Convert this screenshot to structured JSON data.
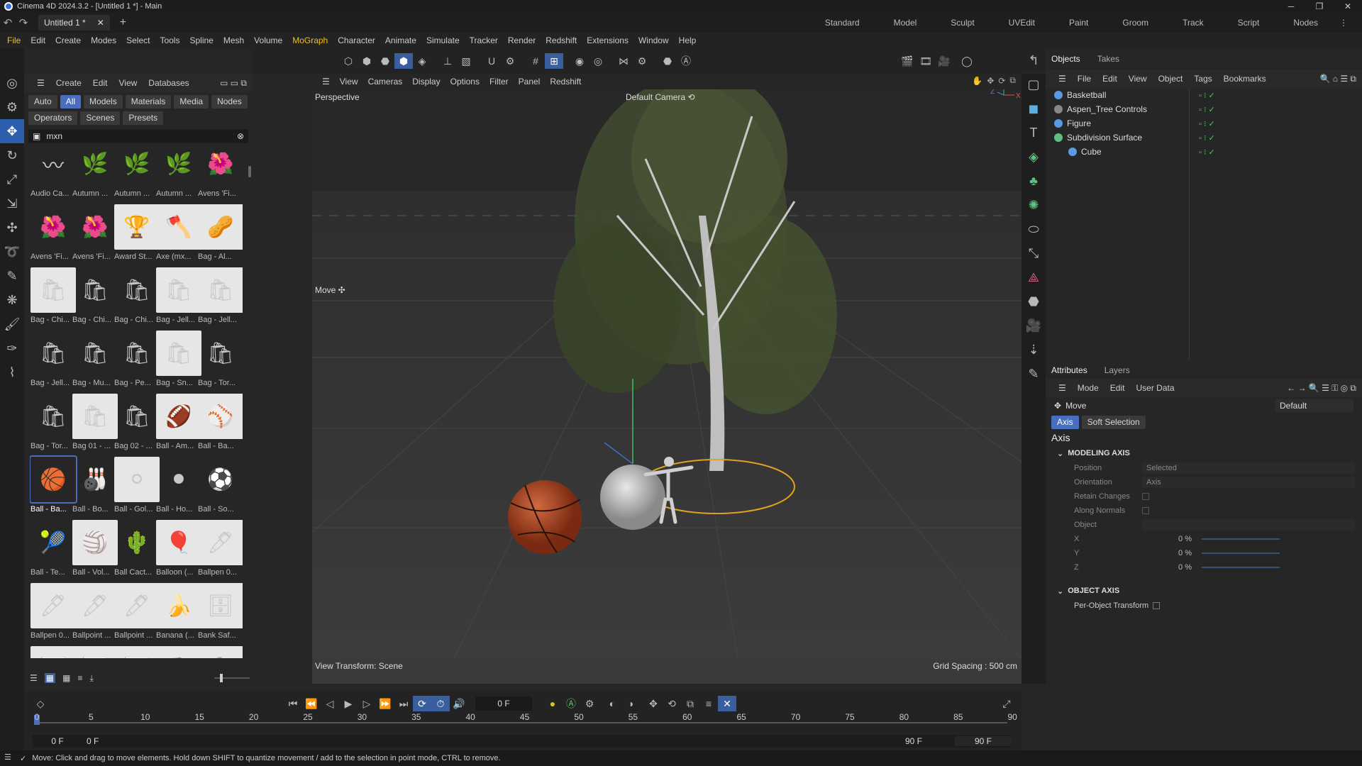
{
  "window": {
    "title": "Cinema 4D 2024.3.2 - [Untitled 1 *] - Main",
    "minimize": "─",
    "maximize": "❐",
    "close": "✕"
  },
  "tabs": {
    "doc": "Untitled 1 *",
    "close": "✕",
    "add": "+",
    "layouts": [
      "Standard",
      "Model",
      "Sculpt",
      "UVEdit",
      "Paint",
      "Groom",
      "Track",
      "Script",
      "Nodes"
    ]
  },
  "menu": [
    "File",
    "Edit",
    "Create",
    "Modes",
    "Select",
    "Tools",
    "Spline",
    "Mesh",
    "Volume",
    "MoGraph",
    "Character",
    "Animate",
    "Simulate",
    "Tracker",
    "Render",
    "Redshift",
    "Extensions",
    "Window",
    "Help"
  ],
  "axes_toolbar": [
    "X",
    "Y",
    "Z"
  ],
  "assets": {
    "menu": [
      "Create",
      "Edit",
      "View",
      "Databases"
    ],
    "chips": [
      "Auto",
      "All",
      "Models",
      "Materials",
      "Media",
      "Nodes",
      "Operators",
      "Scenes",
      "Presets"
    ],
    "search": "mxn",
    "items": [
      {
        "label": "Audio Ca...",
        "icon": "〰"
      },
      {
        "label": "Autumn ...",
        "icon": "🌿"
      },
      {
        "label": "Autumn ...",
        "icon": "🌿"
      },
      {
        "label": "Autumn ...",
        "icon": "🌿"
      },
      {
        "label": "Avens 'Fi...",
        "icon": "🌺"
      },
      {
        "label": "Avens 'Fi...",
        "icon": "🌺"
      },
      {
        "label": "Avens 'Fi...",
        "icon": "🌺"
      },
      {
        "label": "Award St...",
        "icon": "🏆"
      },
      {
        "label": "Axe (mx...",
        "icon": "🪓"
      },
      {
        "label": "Bag - Al...",
        "icon": "🥜"
      },
      {
        "label": "Bag - Chi...",
        "icon": "🛍"
      },
      {
        "label": "Bag - Chi...",
        "icon": "🛍"
      },
      {
        "label": "Bag - Chi...",
        "icon": "🛍"
      },
      {
        "label": "Bag - Jell...",
        "icon": "🛍"
      },
      {
        "label": "Bag - Jell...",
        "icon": "🛍"
      },
      {
        "label": "Bag - Jell...",
        "icon": "🛍"
      },
      {
        "label": "Bag - Mu...",
        "icon": "🛍"
      },
      {
        "label": "Bag - Pe...",
        "icon": "🛍"
      },
      {
        "label": "Bag - Sn...",
        "icon": "🛍"
      },
      {
        "label": "Bag - Tor...",
        "icon": "🛍"
      },
      {
        "label": "Bag - Tor...",
        "icon": "🛍"
      },
      {
        "label": "Bag 01 - ...",
        "icon": "🛍"
      },
      {
        "label": "Bag 02 - ...",
        "icon": "🛍"
      },
      {
        "label": "Ball - Am...",
        "icon": "🏈"
      },
      {
        "label": "Ball - Ba...",
        "icon": "⚾"
      },
      {
        "label": "Ball - Ba...",
        "icon": "🏀"
      },
      {
        "label": "Ball - Bo...",
        "icon": "🎳"
      },
      {
        "label": "Ball - Gol...",
        "icon": "⚪"
      },
      {
        "label": "Ball - Ho...",
        "icon": "⚫"
      },
      {
        "label": "Ball - So...",
        "icon": "⚽"
      },
      {
        "label": "Ball - Te...",
        "icon": "🎾"
      },
      {
        "label": "Ball - Vol...",
        "icon": "🏐"
      },
      {
        "label": "Ball Cact...",
        "icon": "🌵"
      },
      {
        "label": "Balloon (...",
        "icon": "🎈"
      },
      {
        "label": "Ballpen 0...",
        "icon": "🖊"
      },
      {
        "label": "Ballpen 0...",
        "icon": "🖊"
      },
      {
        "label": "Ballpoint ...",
        "icon": "🖊"
      },
      {
        "label": "Ballpoint ...",
        "icon": "🖊"
      },
      {
        "label": "Banana (...",
        "icon": "🍌"
      },
      {
        "label": "Bank Saf...",
        "icon": "🗄"
      },
      {
        "label": "",
        "icon": "📊"
      },
      {
        "label": "",
        "icon": "📊"
      },
      {
        "label": "",
        "icon": "📊"
      },
      {
        "label": "",
        "icon": "🪑"
      },
      {
        "label": "",
        "icon": "🔨"
      }
    ]
  },
  "viewport": {
    "menu": [
      "View",
      "Cameras",
      "Display",
      "Options",
      "Filter",
      "Panel",
      "Redshift"
    ],
    "name": "Perspective",
    "camera": "Default Camera ⟲",
    "tool": "Move ✣",
    "transform": "View Transform: Scene",
    "grid": "Grid Spacing : 500 cm"
  },
  "objects": {
    "tabs": [
      "Objects",
      "Takes"
    ],
    "menu": [
      "File",
      "Edit",
      "View",
      "Object",
      "Tags",
      "Bookmarks"
    ],
    "items": [
      {
        "name": "Basketball",
        "color": "#5a9ae0",
        "indent": 0
      },
      {
        "name": "Aspen_Tree Controls",
        "color": "#888888",
        "indent": 0
      },
      {
        "name": "Figure",
        "color": "#5a9ae0",
        "indent": 0
      },
      {
        "name": "Subdivision Surface",
        "color": "#60c080",
        "indent": 0
      },
      {
        "name": "Cube",
        "color": "#5a9ae0",
        "indent": 1
      }
    ]
  },
  "attributes": {
    "tabs": [
      "Attributes",
      "Layers"
    ],
    "menu": [
      "Mode",
      "Edit",
      "User Data"
    ],
    "tool": "Move",
    "preset": "Default",
    "subtabs": [
      "Axis",
      "Soft Selection"
    ],
    "heading": "Axis",
    "modeling": "MODELING AXIS",
    "position_label": "Position",
    "position_val": "Selected",
    "orientation_label": "Orientation",
    "orientation_val": "Axis",
    "retain": "Retain Changes",
    "normals": "Along Normals",
    "object": "Object",
    "x": "X",
    "y": "Y",
    "z": "Z",
    "xv": "0 %",
    "yv": "0 %",
    "zv": "0 %",
    "object_axis": "OBJECT AXIS",
    "per_object": "Per-Object Transform"
  },
  "timeline": {
    "frame": "0 F",
    "ticks": [
      "0",
      "5",
      "10",
      "15",
      "20",
      "25",
      "30",
      "35",
      "40",
      "45",
      "50",
      "55",
      "60",
      "65",
      "70",
      "75",
      "80",
      "85",
      "90"
    ],
    "start": "0 F",
    "start2": "0 F",
    "end": "90 F",
    "end2": "90 F"
  },
  "status": "Move: Click and drag to move elements. Hold down SHIFT to quantize movement / add to the selection in point mode, CTRL to remove."
}
